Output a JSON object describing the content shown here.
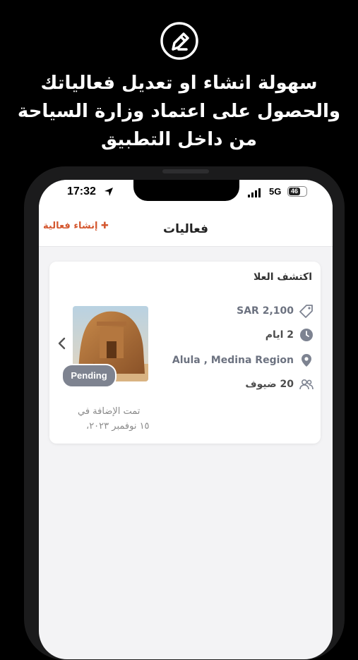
{
  "promo": {
    "icon": "pencil-edit-icon",
    "line1": "سهولة انشاء او تعديل فعالياتك",
    "line2": "والحصول على اعتماد وزارة السياحة",
    "line3": "من داخل التطبيق"
  },
  "status_bar": {
    "time": "17:32",
    "network": "5G",
    "battery": "46"
  },
  "nav": {
    "title": "فعاليات",
    "create_label": "✚ إنشاء فعالية"
  },
  "event": {
    "title": "اكتشف العلا",
    "price": "SAR 2,100",
    "duration": "2 ايام",
    "location": "Alula , Medina Region",
    "guests": "20 ضيوف",
    "status": "Pending",
    "added_label": "تمت الإضافة في",
    "added_date": "١٥ نوفمبر ٢٠٢٣،"
  },
  "colors": {
    "accent": "#d4572f",
    "status_badge": "#7e8390",
    "icon_gray": "#7d8391"
  }
}
